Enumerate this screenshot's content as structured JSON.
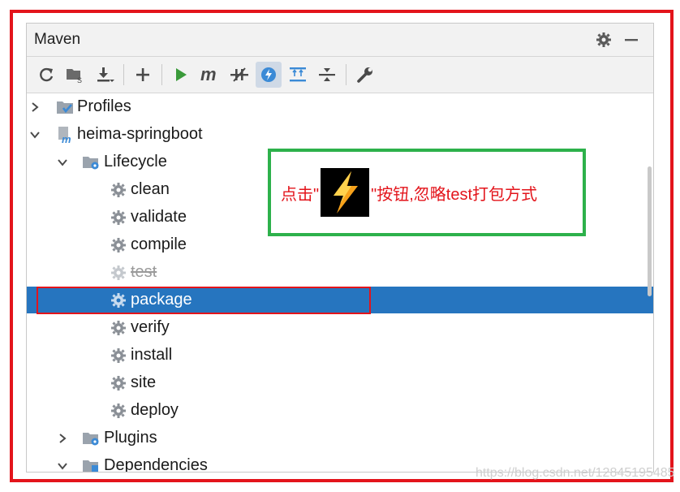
{
  "panel": {
    "title": "Maven"
  },
  "toolbar": {
    "buttons": [
      {
        "name": "reimport",
        "icon": "refresh-icon"
      },
      {
        "name": "generate-sources",
        "icon": "folder-generate-icon"
      },
      {
        "name": "download-sources",
        "icon": "download-icon"
      },
      {
        "name": "add-project",
        "icon": "plus-icon"
      },
      {
        "name": "run",
        "icon": "play-icon"
      },
      {
        "name": "execute-goal",
        "icon": "maven-m-icon"
      },
      {
        "name": "toggle-offline",
        "icon": "offline-icon"
      },
      {
        "name": "skip-tests",
        "icon": "lightning-icon",
        "active": true
      },
      {
        "name": "show-dependencies",
        "icon": "expand-icon"
      },
      {
        "name": "collapse-all",
        "icon": "collapse-icon"
      },
      {
        "name": "maven-settings",
        "icon": "wrench-icon"
      }
    ]
  },
  "tree": {
    "profiles": "Profiles",
    "project": "heima-springboot",
    "lifecycle": "Lifecycle",
    "goals": {
      "clean": "clean",
      "validate": "validate",
      "compile": "compile",
      "test": "test",
      "package": "package",
      "verify": "verify",
      "install": "install",
      "site": "site",
      "deploy": "deploy"
    },
    "plugins": "Plugins",
    "dependencies": "Dependencies"
  },
  "callout": {
    "prefix": "点击\"",
    "suffix": "\"按钮,忽略test打包方式"
  },
  "watermark": "https://blog.csdn.net/12845195485",
  "colors": {
    "frame": "#e3141b",
    "callout_border": "#2db14b",
    "selection": "#2675bf",
    "run_green": "#3a9a3a"
  }
}
